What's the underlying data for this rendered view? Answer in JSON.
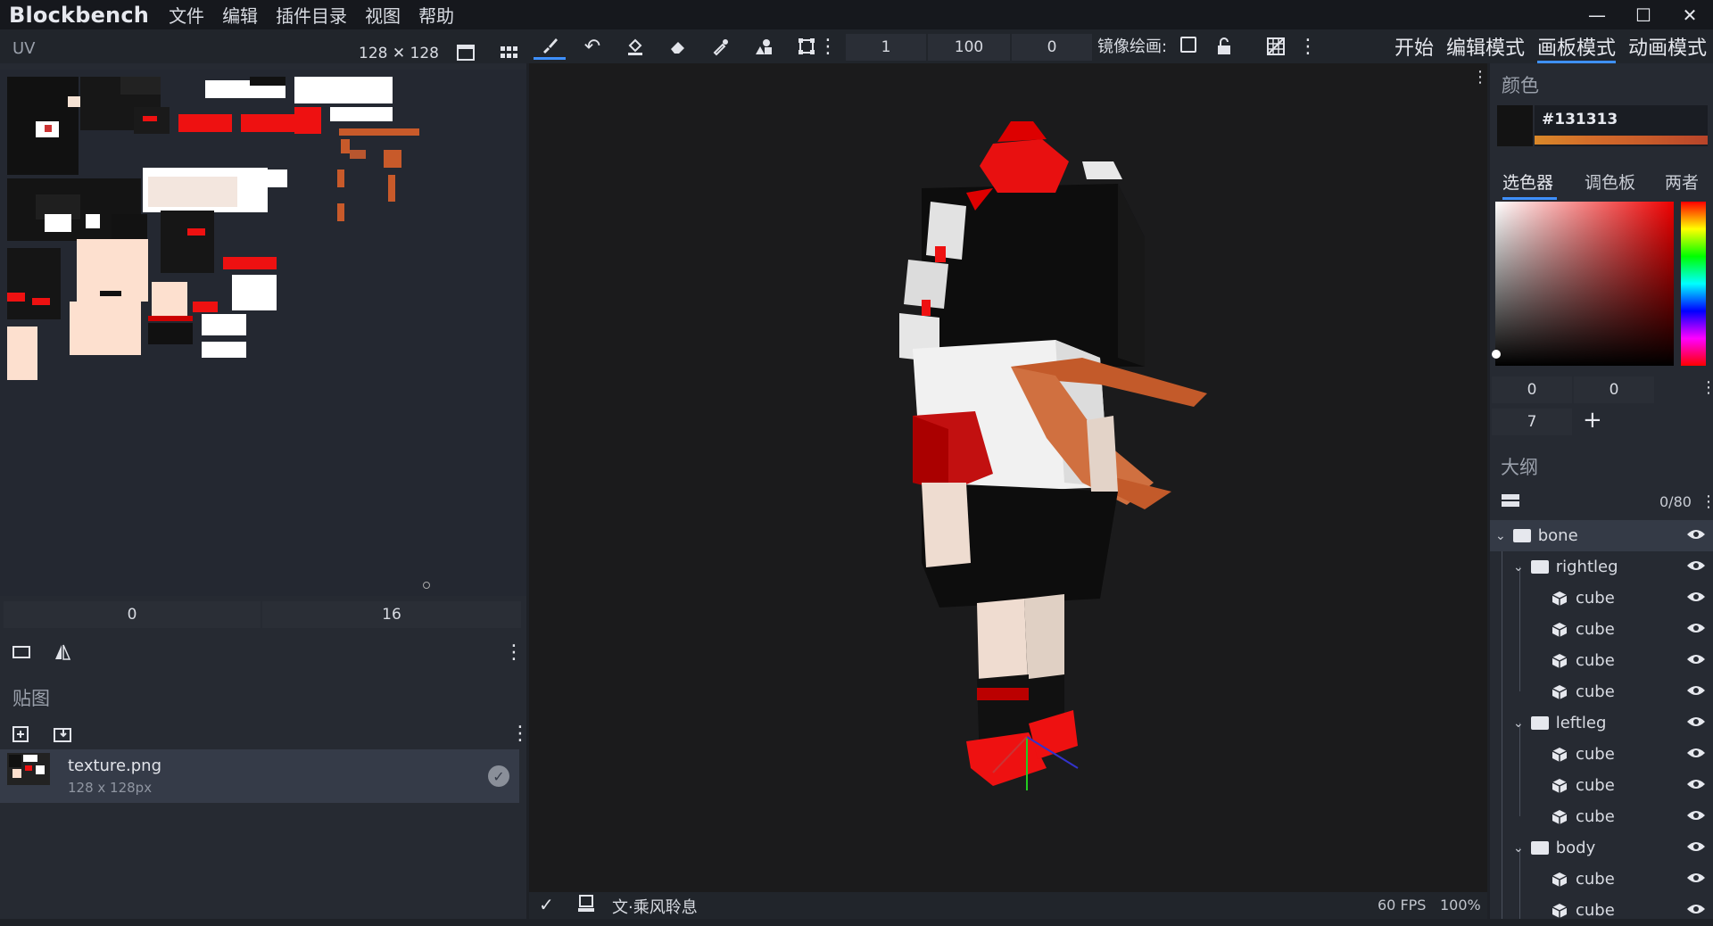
{
  "window": {
    "app_title": "Blockbench",
    "menu": [
      "文件",
      "编辑",
      "插件目录",
      "视图",
      "帮助"
    ]
  },
  "toolbar": {
    "brush_size": "1",
    "opacity": "100",
    "softness": "0",
    "mirror_label": "镜像绘画:"
  },
  "modes": [
    "开始",
    "编辑模式",
    "画板模式",
    "动画模式"
  ],
  "uv_panel": {
    "title": "UV",
    "size_label": "128 ✕ 128",
    "field_left": "0",
    "field_right": "16"
  },
  "textures": {
    "title": "贴图",
    "items": [
      {
        "name": "texture.png",
        "size": "128 x 128px"
      }
    ]
  },
  "color_panel": {
    "title": "颜色",
    "hex": "#131313",
    "tabs": [
      "选色器",
      "调色板",
      "两者"
    ],
    "field_a": "0",
    "field_b": "0",
    "field_c": "7",
    "add": "+"
  },
  "outliner": {
    "title": "大纲",
    "count": "0/80",
    "rows": [
      {
        "label": "bone",
        "kind": "folder",
        "depth": 0,
        "selected": true
      },
      {
        "label": "rightleg",
        "kind": "folder",
        "depth": 1
      },
      {
        "label": "cube",
        "kind": "cube",
        "depth": 2
      },
      {
        "label": "cube",
        "kind": "cube",
        "depth": 2
      },
      {
        "label": "cube",
        "kind": "cube",
        "depth": 2
      },
      {
        "label": "cube",
        "kind": "cube",
        "depth": 2
      },
      {
        "label": "leftleg",
        "kind": "folder",
        "depth": 1
      },
      {
        "label": "cube",
        "kind": "cube",
        "depth": 2
      },
      {
        "label": "cube",
        "kind": "cube",
        "depth": 2
      },
      {
        "label": "cube",
        "kind": "cube",
        "depth": 2
      },
      {
        "label": "body",
        "kind": "folder",
        "depth": 1
      },
      {
        "label": "cube",
        "kind": "cube",
        "depth": 2
      },
      {
        "label": "cube",
        "kind": "cube",
        "depth": 2
      }
    ]
  },
  "status": {
    "project_name": "文·乘风聆息",
    "fps": "60 FPS",
    "zoom": "100%"
  },
  "colors": {
    "accent": "#3e90ff",
    "selected_color": "#131313"
  }
}
